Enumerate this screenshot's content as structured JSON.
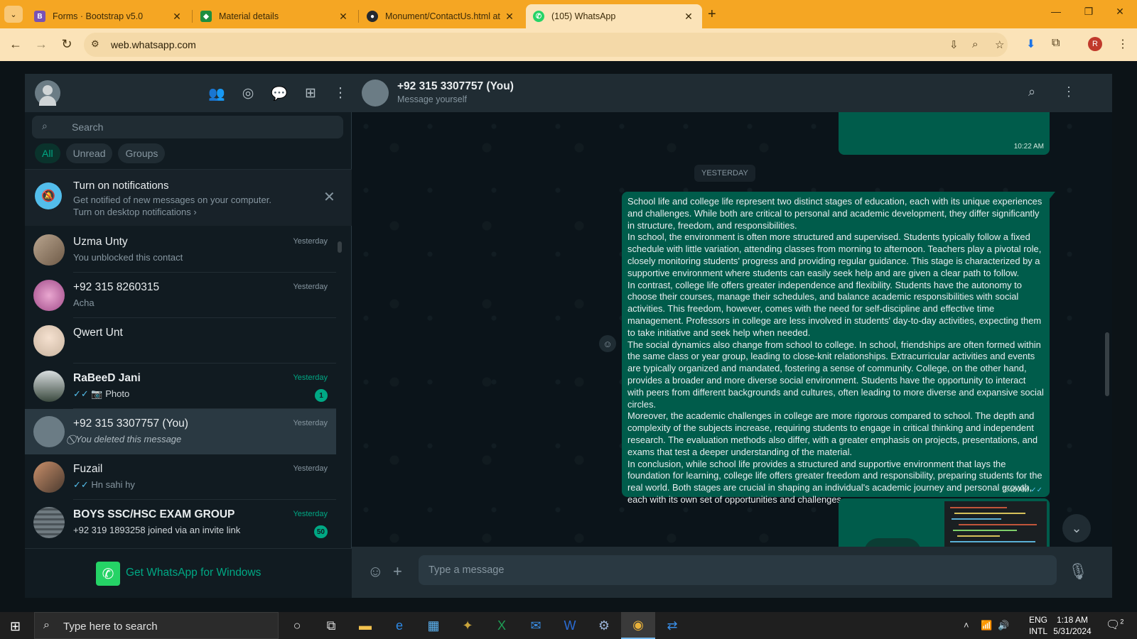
{
  "browser": {
    "tabs": [
      {
        "title": "Forms · Bootstrap v5.0",
        "favicon": "B",
        "color": "#7952b3"
      },
      {
        "title": "Material details",
        "favicon": "◆",
        "color": "#1e8e3e"
      },
      {
        "title": "Monument/ContactUs.html at n",
        "favicon": "●",
        "color": "#24292f"
      },
      {
        "title": "(105) WhatsApp",
        "favicon": "✆",
        "color": "#25d366"
      }
    ],
    "url": "web.whatsapp.com",
    "profile_initial": "R"
  },
  "sidebar": {
    "search_placeholder": "Search",
    "filters": [
      "All",
      "Unread",
      "Groups"
    ],
    "notification": {
      "title": "Turn on notifications",
      "subtitle": "Get notified of new messages on your computer.",
      "link": "Turn on desktop notifications ›"
    },
    "chats": [
      {
        "name": "Uzma Unty",
        "message": "You unblocked this contact",
        "time": "Yesterday"
      },
      {
        "name": "+92 315 8260315",
        "message": "Acha",
        "time": "Yesterday"
      },
      {
        "name": "Qwert Unt",
        "message": "",
        "time": ""
      },
      {
        "name": "RaBeeD Jani",
        "message": "Photo",
        "time": "Yesterday",
        "badge": "1"
      },
      {
        "name": "+92 315 3307757 (You)",
        "message": "You deleted this message",
        "time": "Yesterday"
      },
      {
        "name": "Fuzail",
        "message": "Hn sahi hy",
        "time": "Yesterday"
      },
      {
        "name": "BOYS SSC/HSC EXAM GROUP",
        "message": "+92 319 1893258 joined via an invite link",
        "time": "Yesterday",
        "badge": "50"
      }
    ],
    "get_app": "Get WhatsApp for Windows"
  },
  "conversation": {
    "title": "+92 315 3307757 (You)",
    "subtitle": "Message yourself",
    "top_time": "10:22 AM",
    "day_label": "YESTERDAY",
    "message_paragraphs": [
      "School life and college life represent two distinct stages of education, each with its unique experiences and challenges. While both are critical to personal and academic development, they differ significantly in structure, freedom, and responsibilities.",
      "In school, the environment is often more structured and supervised. Students typically follow a fixed schedule with little variation, attending classes from morning to afternoon. Teachers play a pivotal role, closely monitoring students' progress and providing regular guidance. This stage is characterized by a supportive environment where students can easily seek help and are given a clear path to follow.",
      "In contrast, college life offers greater independence and flexibility. Students have the autonomy to choose their courses, manage their schedules, and balance academic responsibilities with social activities. This freedom, however, comes with the need for self-discipline and effective time management. Professors in college are less involved in students' day-to-day activities, expecting them to take initiative and seek help when needed.",
      "The social dynamics also change from school to college. In school, friendships are often formed within the same class or year group, leading to close-knit relationships. Extracurricular activities and events are typically organized and mandated, fostering a sense of community. College, on the other hand, provides a broader and more diverse social environment. Students have the opportunity to interact with peers from different backgrounds and cultures, often leading to more diverse and expansive social circles.",
      "Moreover, the academic challenges in college are more rigorous compared to school. The depth and complexity of the subjects increase, requiring students to engage in critical thinking and independent research. The evaluation methods also differ, with a greater emphasis on projects, presentations, and exams that test a deeper understanding of the material.",
      "In conclusion, while school life provides a structured and supportive environment that lays the foundation for learning, college life offers greater freedom and responsibility, preparing students for the real world. Both stages are crucial in shaping an individual's academic journey and personal growth, each with its own set of opportunities and challenges."
    ],
    "message_time": "2:40 AM",
    "compose_placeholder": "Type a message"
  },
  "taskbar": {
    "search_placeholder": "Type here to search",
    "lang_line1": "ENG",
    "lang_line2": "INTL",
    "time": "1:18 AM",
    "date": "5/31/2024",
    "notification_count": "2"
  },
  "colors": {
    "accent": "#00a884",
    "outgoing_bubble": "#005c4b",
    "panel": "#202c33",
    "background": "#111b21"
  }
}
